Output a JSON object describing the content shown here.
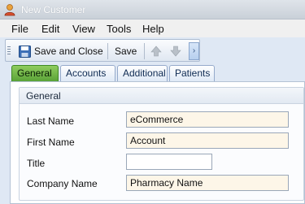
{
  "window": {
    "title": "New Customer"
  },
  "menu": {
    "items": [
      "File",
      "Edit",
      "View",
      "Tools",
      "Help"
    ]
  },
  "toolbar": {
    "save_close_label": "Save and Close",
    "save_label": "Save",
    "overflow_label": "›"
  },
  "tabs": [
    "General",
    "Accounts",
    "Additional",
    "Patients"
  ],
  "form": {
    "group_title": "General",
    "last_name": {
      "label": "Last Name",
      "value": "eCommerce"
    },
    "first_name": {
      "label": "First Name",
      "value": "Account"
    },
    "title": {
      "label": "Title",
      "value": ""
    },
    "company_name": {
      "label": "Company Name",
      "value": "Pharmacy Name"
    }
  },
  "colors": {
    "active_tab": "#5aa338",
    "required_field_bg": "#fdf6e8",
    "window_bg": "#dfe8f4"
  },
  "icons": {
    "app": "customer-person-icon",
    "save_close": "save-icon",
    "move_up": "arrow-up-icon",
    "move_down": "arrow-down-icon"
  }
}
